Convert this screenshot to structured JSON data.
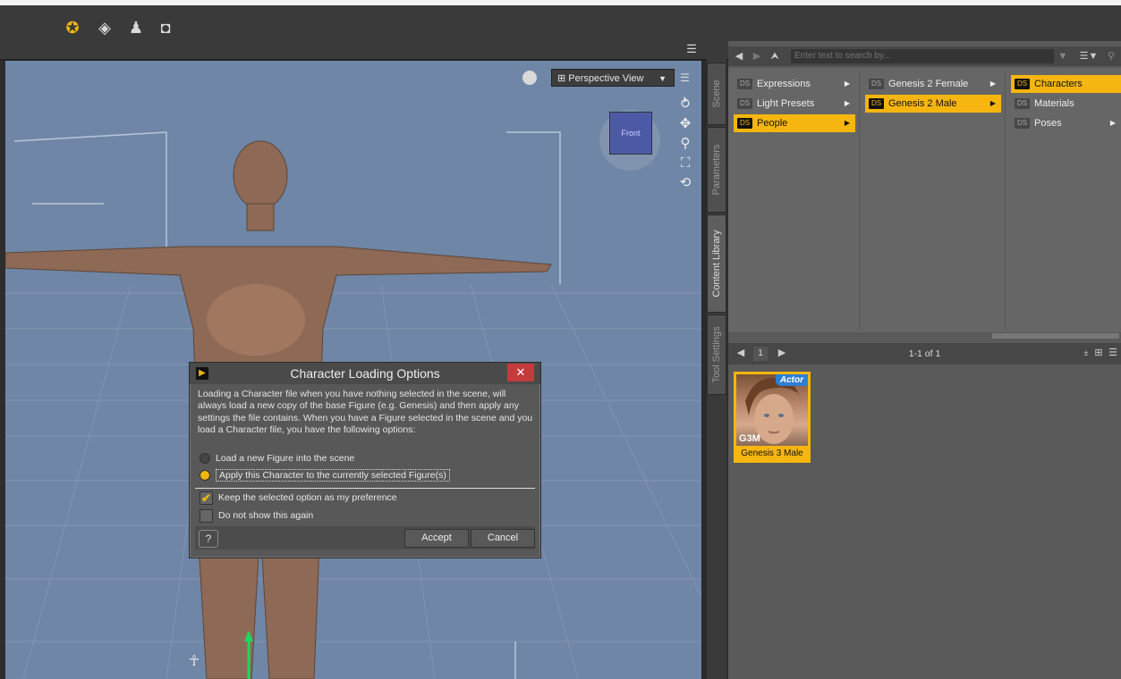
{
  "toolbar": {
    "icons": [
      "universal-tool-icon",
      "rotate-tool-icon",
      "figure-tool-icon",
      "camera-tool-icon"
    ]
  },
  "viewport": {
    "view_label": "Perspective View",
    "cube_label": "Front",
    "side_tools": [
      "orbit-icon",
      "pan-icon",
      "zoom-icon",
      "frame-icon",
      "reset-icon"
    ]
  },
  "dialog": {
    "title": "Character Loading Options",
    "description": "Loading a Character file when you have nothing selected in the scene, will always load a new copy of the base Figure (e.g. Genesis) and then apply any settings the file contains. When you have a Figure selected in the scene and you load a Character file, you have the following options:",
    "option_new": "Load a new Figure into the scene",
    "option_apply": "Apply this Character to the currently selected Figure(s)",
    "keep_pref": "Keep the selected option as my preference",
    "no_show": "Do not show this again",
    "accept": "Accept",
    "cancel": "Cancel",
    "help": "?"
  },
  "tabs": {
    "scene": "Scene",
    "parameters": "Parameters",
    "content_library": "Content Library",
    "tool_settings": "Tool Settings"
  },
  "library": {
    "search_placeholder": "Enter text to search by...",
    "col1": [
      "Expressions",
      "Light Presets",
      "People"
    ],
    "col2": [
      "Genesis 2 Female",
      "Genesis 2 Male"
    ],
    "col3": [
      "Characters",
      "Materials",
      "Poses"
    ],
    "page": "1",
    "count": "1-1 of 1",
    "item": {
      "label": "Genesis 3 Male",
      "badge": "Actor",
      "code": "G3M"
    }
  },
  "colors": {
    "accent": "#f6b60f",
    "viewport": "#6f86a6",
    "close": "#c33b3b"
  }
}
